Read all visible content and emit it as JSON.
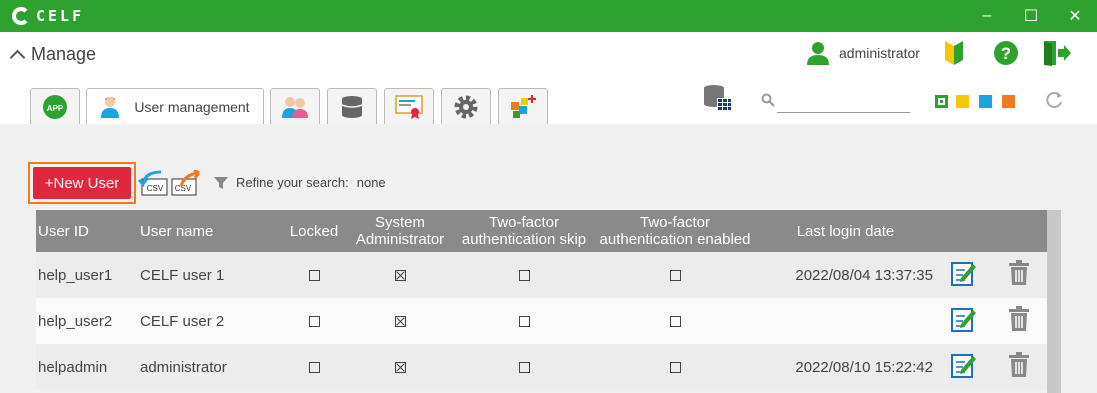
{
  "app": {
    "title": "CELF"
  },
  "window_controls": {
    "minimize": "–",
    "maximize": "☐",
    "close": "✕"
  },
  "header": {
    "manage_label": "Manage",
    "user_name": "administrator"
  },
  "tabs": [
    {
      "icon": "app-icon",
      "label": "APP"
    },
    {
      "icon": "user-icon",
      "label": "User management"
    },
    {
      "icon": "group-icon",
      "label": ""
    },
    {
      "icon": "database-icon",
      "label": ""
    },
    {
      "icon": "certificate-icon",
      "label": ""
    },
    {
      "icon": "gear-icon",
      "label": ""
    },
    {
      "icon": "blocks-add-icon",
      "label": ""
    }
  ],
  "search": {
    "placeholder": ""
  },
  "theme_colors": [
    "#2ea22e",
    "#f5c800",
    "#1aa5e0",
    "#f07a1e"
  ],
  "toolbar": {
    "new_user": "+New User",
    "csv_import": "CSV",
    "csv_export": "CSV",
    "refine_label": "Refine your search:",
    "refine_value": "none"
  },
  "table": {
    "headers": {
      "user_id": "User ID",
      "user_name": "User name",
      "locked": "Locked",
      "sysadmin_1": "System",
      "sysadmin_2": "Administrator",
      "tfa_skip_1": "Two-factor",
      "tfa_skip_2": "authentication skip",
      "tfa_enabled_1": "Two-factor",
      "tfa_enabled_2": "authentication enabled",
      "last_login": "Last login date"
    },
    "rows": [
      {
        "user_id": "help_user1",
        "user_name": "CELF user 1",
        "locked": false,
        "sysadmin": true,
        "tfa_skip": false,
        "tfa_enabled": false,
        "last_login": "2022/08/04 13:37:35"
      },
      {
        "user_id": "help_user2",
        "user_name": "CELF user 2",
        "locked": false,
        "sysadmin": true,
        "tfa_skip": false,
        "tfa_enabled": false,
        "last_login": ""
      },
      {
        "user_id": "helpadmin",
        "user_name": "administrator",
        "locked": false,
        "sysadmin": true,
        "tfa_skip": false,
        "tfa_enabled": false,
        "last_login": "2022/08/10 15:22:42"
      }
    ]
  }
}
